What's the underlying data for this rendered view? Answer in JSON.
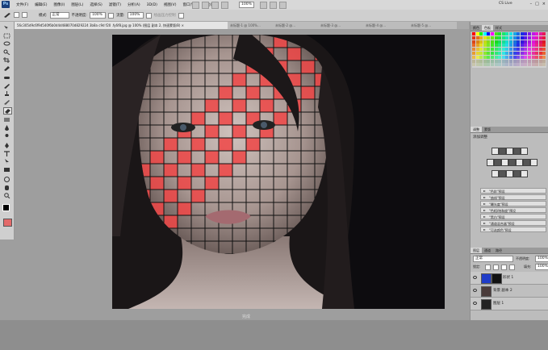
{
  "menubar": {
    "app_logo": "Ps",
    "menus": [
      "文件(F)",
      "编辑(E)",
      "图像(I)",
      "图层(L)",
      "选择(S)",
      "滤镜(T)",
      "分析(A)",
      "3D(D)",
      "视图(V)",
      "窗口(W)",
      "帮助(H)"
    ],
    "zoom": "100%",
    "cs_live": "CS Live",
    "win_buttons": [
      "–",
      "□",
      "×"
    ]
  },
  "optionsbar": {
    "mode_label": "模式:",
    "mode_value": "正常",
    "opacity_label": "不透明度:",
    "opacity_value": "100%",
    "flow_label": "流量:",
    "flow_value": "100%",
    "pen_pressure_label": "绘画压力控制"
  },
  "tabs": {
    "active": "56c305d9c6f9d540f6b0d4d488070d829224 3b8a c9d f20 .fy6f8.jpg @ 100% (图层 副本 2, 快速蒙版/8) ×",
    "others": [
      "未标题-1 @ 100%...",
      "未标题-2 @...",
      "未标题-3 @...",
      "未标题-4 @...",
      "未标题-5 @..."
    ]
  },
  "right_panel": {
    "color_tabs": [
      "颜色",
      "色板",
      "样式"
    ],
    "adjust_tabs": [
      "调整",
      "蒙版"
    ],
    "adjust_title": "添加调整",
    "presets": [
      "\"色阶\"预设",
      "\"曲线\"预设",
      "\"曝光度\"预设",
      "\"色相/饱和度\"预设",
      "\"黑白\"预设",
      "\"通道混合器\"预设",
      "\"可选颜色\"预设"
    ],
    "layer_tabs": [
      "图层",
      "通道",
      "路径"
    ],
    "blend_mode": "正常",
    "opacity_label": "不透明度:",
    "opacity_value": "100%",
    "lock_label": "锁定:",
    "fill_label": "填充:",
    "fill_value": "100%",
    "layers": [
      {
        "name": "形状 1"
      },
      {
        "name": "背景 副本 2"
      },
      {
        "name": "图层 1"
      }
    ]
  },
  "status": {
    "text": "完成"
  },
  "colors": {
    "grid_red": "#f04646",
    "ui_gray": "#cfcfcf",
    "layer_thumb_blue": "#1f3cc8"
  }
}
